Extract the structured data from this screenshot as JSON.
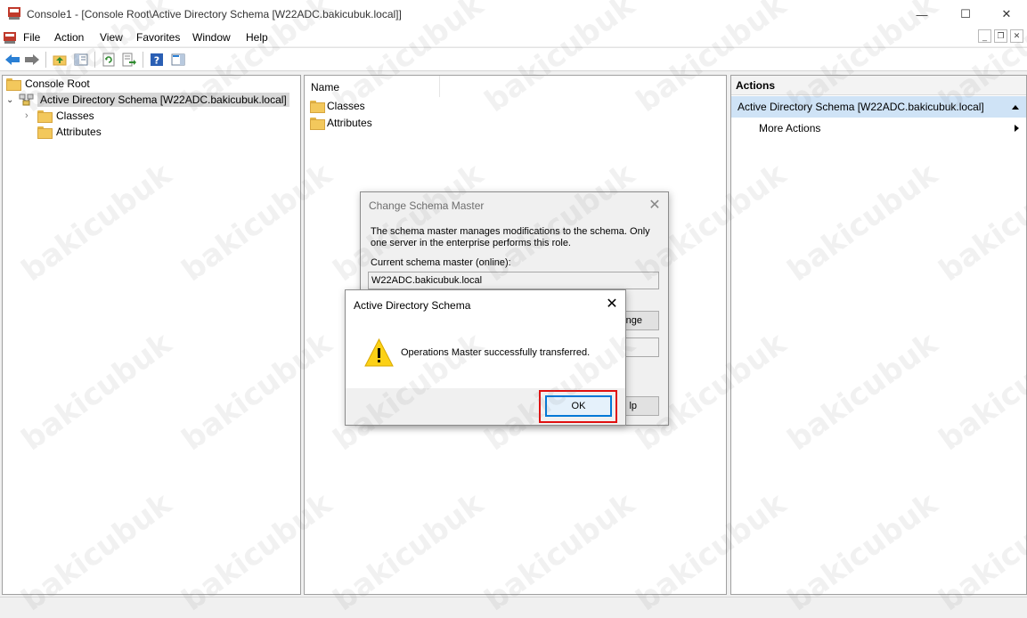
{
  "window": {
    "title": "Console1 - [Console Root\\Active Directory Schema [W22ADC.bakicubuk.local]]",
    "controls": {
      "minimize": "—",
      "maximize": "☐",
      "close": "✕"
    }
  },
  "menu": [
    "File",
    "Action",
    "View",
    "Favorites",
    "Window",
    "Help"
  ],
  "toolbar_icons": [
    "back-icon",
    "forward-icon",
    "up-folder-icon",
    "show-hide-tree-icon",
    "refresh-icon",
    "export-list-icon",
    "help-icon",
    "show-hide-action-pane-icon"
  ],
  "tree": {
    "root": "Console Root",
    "snapin": "Active Directory Schema [W22ADC.bakicubuk.local]",
    "children": [
      "Classes",
      "Attributes"
    ]
  },
  "list": {
    "column_name": "Name",
    "items": [
      "Classes",
      "Attributes"
    ]
  },
  "actions": {
    "title": "Actions",
    "section": "Active Directory Schema [W22ADC.bakicubuk.local]",
    "items": [
      "More Actions"
    ]
  },
  "change_schema_dialog": {
    "title": "Change Schema Master",
    "description": "The schema master manages modifications to the schema. Only one server in the enterprise performs this role.",
    "current_label": "Current schema master (online):",
    "current_value": "W22ADC.bakicubuk.local",
    "change_button_partial": "nge",
    "help_button_partial": "lp"
  },
  "message_dialog": {
    "title": "Active Directory Schema",
    "message": "Operations Master successfully transferred.",
    "ok_label": "OK"
  },
  "watermark": "bakicubuk",
  "colors": {
    "accent_highlight": "#cfe3f6",
    "ok_focus_border": "#0078d7",
    "annotation_red": "#e01010"
  }
}
